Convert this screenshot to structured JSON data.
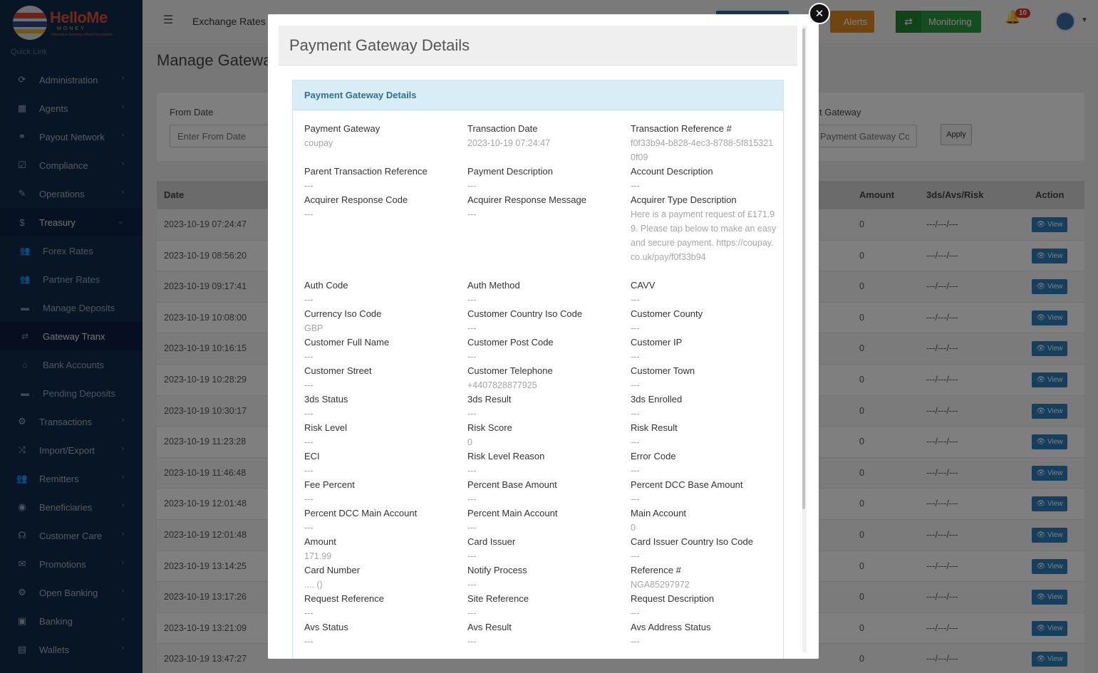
{
  "logo": {
    "name": "HelloMe",
    "sub": "MONEY",
    "tagline": "Alternative banking without boundaries"
  },
  "sidebar": {
    "quick_link": "Quick Link",
    "items": [
      {
        "label": "Administration",
        "icon": "circle-arrow-icon"
      },
      {
        "label": "Agents",
        "icon": "building-icon"
      },
      {
        "label": "Payout Network",
        "icon": "handshake-icon"
      },
      {
        "label": "Compliance",
        "icon": "check-square-icon"
      },
      {
        "label": "Operations",
        "icon": "wrench-icon"
      },
      {
        "label": "Treasury",
        "icon": "dollar-icon"
      }
    ],
    "treasury_sub": [
      {
        "label": "Forex Rates",
        "icon": "users-icon"
      },
      {
        "label": "Partner Rates",
        "icon": "users-icon"
      },
      {
        "label": "Manage Deposits",
        "icon": "card-icon"
      },
      {
        "label": "Gateway Tranx",
        "icon": "exchange-icon"
      },
      {
        "label": "Bank Accounts",
        "icon": "bank-icon"
      },
      {
        "label": "Pending Deposits",
        "icon": "card-icon"
      }
    ],
    "items_after": [
      {
        "label": "Transactions",
        "icon": "cogs-icon"
      },
      {
        "label": "Import/Export",
        "icon": "shuffle-icon"
      },
      {
        "label": "Remitters",
        "icon": "users-icon"
      },
      {
        "label": "Beneficiaries",
        "icon": "user-circle-icon"
      },
      {
        "label": "Customer Care",
        "icon": "headset-icon"
      },
      {
        "label": "Promotions",
        "icon": "gift-icon"
      },
      {
        "label": "Open Banking",
        "icon": "gear-icon"
      },
      {
        "label": "Banking",
        "icon": "money-icon"
      },
      {
        "label": "Wallets",
        "icon": "wallet-icon"
      }
    ]
  },
  "topbar": {
    "exchange_rates": "Exchange Rates",
    "alerts": "Alerts",
    "monitoring": "Monitoring",
    "notif_count": "10"
  },
  "page": {
    "title": "Manage Gatewa",
    "from_date_label": "From Date",
    "from_date_placeholder": "Enter From Date",
    "gateway_label": "t Gateway",
    "gateway_placeholder": "Payment Gateway Cod",
    "apply": "Apply",
    "columns": {
      "date": "Date",
      "amount": "Amount",
      "risk": "3ds/Avs/Risk",
      "action": "Action"
    },
    "rows": [
      {
        "date": "2023-10-19 07:24:47",
        "amount": "0",
        "risk": "---/---/---",
        "action": "View"
      },
      {
        "date": "2023-10-19 08:56:20",
        "amount": "0",
        "risk": "---/---/---",
        "action": "View"
      },
      {
        "date": "2023-10-19 09:17:41",
        "amount": "0",
        "risk": "---/---/---",
        "action": "View"
      },
      {
        "date": "2023-10-19 10:08:00",
        "amount": "0",
        "risk": "---/---/---",
        "action": "View"
      },
      {
        "date": "2023-10-19 10:16:15",
        "amount": "0",
        "risk": "---/---/---",
        "action": "View"
      },
      {
        "date": "2023-10-19 10:28:29",
        "amount": "0",
        "risk": "---/---/---",
        "action": "View"
      },
      {
        "date": "2023-10-19 10:30:17",
        "amount": "0",
        "risk": "---/---/---",
        "action": "View"
      },
      {
        "date": "2023-10-19 11:23:28",
        "amount": "0",
        "risk": "---/---/---",
        "action": "View"
      },
      {
        "date": "2023-10-19 11:46:48",
        "amount": "0",
        "risk": "---/---/---",
        "action": "View"
      },
      {
        "date": "2023-10-19 12:01:48",
        "amount": "0",
        "risk": "---/---/---",
        "action": "View"
      },
      {
        "date": "2023-10-19 12:01:48",
        "amount": "0",
        "risk": "---/---/---",
        "action": "View"
      },
      {
        "date": "2023-10-19 13:14:25",
        "amount": "0",
        "risk": "---/---/---",
        "action": "View"
      },
      {
        "date": "2023-10-19 13:17:26",
        "amount": "0",
        "risk": "---/---/---",
        "action": "View"
      },
      {
        "date": "2023-10-19 13:21:09",
        "amount": "0",
        "risk": "---/---/---",
        "action": "View"
      },
      {
        "date": "2023-10-19 13:47:27",
        "amount": "0",
        "risk": "---/---/---",
        "action": "View"
      }
    ]
  },
  "modal": {
    "title": "Payment Gateway Details",
    "panel_title": "Payment Gateway Details",
    "rows": [
      [
        {
          "k": "Payment Gateway",
          "v": "coupay"
        },
        {
          "k": "Transaction Date",
          "v": "2023-10-19 07:24:47"
        },
        {
          "k": "Transaction Reference #",
          "v": "f0f33b94-b828-4ec3-8788-5f8153210f09"
        }
      ],
      [
        {
          "k": "Parent Transaction Reference",
          "v": "---"
        },
        {
          "k": "Payment Description",
          "v": "---"
        },
        {
          "k": "Account Description",
          "v": "---"
        }
      ],
      [
        {
          "k": "Acquirer Response Code",
          "v": "---"
        },
        {
          "k": "Acquirer Response Message",
          "v": "---"
        },
        {
          "k": "Acquirer Type Description",
          "v": "Here is a payment request of £171.99. Please tap below to make an easy and secure payment. https://coupay.co.uk/pay/f0f33b94"
        }
      ],
      [
        {
          "k": "Auth Code",
          "v": "---"
        },
        {
          "k": "Auth Method",
          "v": "---"
        },
        {
          "k": "CAVV",
          "v": "---"
        }
      ],
      [
        {
          "k": "Currency Iso Code",
          "v": "GBP"
        },
        {
          "k": "Customer Country Iso Code",
          "v": "---"
        },
        {
          "k": "Customer County",
          "v": "---"
        }
      ],
      [
        {
          "k": "Customer Full Name",
          "v": "---"
        },
        {
          "k": "Customer Post Code",
          "v": "---"
        },
        {
          "k": "Customer IP",
          "v": "---"
        }
      ],
      [
        {
          "k": "Customer Street",
          "v": "---"
        },
        {
          "k": "Customer Telephone",
          "v": "+4407828877925"
        },
        {
          "k": "Customer Town",
          "v": "---"
        }
      ],
      [
        {
          "k": "3ds Status",
          "v": "---"
        },
        {
          "k": "3ds Result",
          "v": "---"
        },
        {
          "k": "3ds Enrolled",
          "v": "---"
        }
      ],
      [
        {
          "k": "Risk Level",
          "v": "---"
        },
        {
          "k": "Risk Score",
          "v": "0"
        },
        {
          "k": "Risk Result",
          "v": "---"
        }
      ],
      [
        {
          "k": "ECI",
          "v": "---"
        },
        {
          "k": "Risk Level Reason",
          "v": "---"
        },
        {
          "k": "Error Code",
          "v": "---"
        }
      ],
      [
        {
          "k": "Fee Percent",
          "v": "---"
        },
        {
          "k": "Percent Base Amount",
          "v": "---"
        },
        {
          "k": "Percent DCC Base Amount",
          "v": "---"
        }
      ],
      [
        {
          "k": "Percent DCC Main Account",
          "v": "---"
        },
        {
          "k": "Percent Main Account",
          "v": "---"
        },
        {
          "k": "Main Account",
          "v": "0"
        }
      ],
      [
        {
          "k": "Amount",
          "v": "171.99"
        },
        {
          "k": "Card Issuer",
          "v": "---"
        },
        {
          "k": "Card Issuer Country Iso Code",
          "v": "---"
        }
      ],
      [
        {
          "k": "Card Number",
          "v": ".... ()"
        },
        {
          "k": "Notify Process",
          "v": "---"
        },
        {
          "k": "Reference #",
          "v": "NGA85297972"
        }
      ],
      [
        {
          "k": "Request Reference",
          "v": "---"
        },
        {
          "k": "Site Reference",
          "v": "---"
        },
        {
          "k": "Request Description",
          "v": "---"
        }
      ],
      [
        {
          "k": "Avs Status",
          "v": "---"
        },
        {
          "k": "Avs Result",
          "v": "---"
        },
        {
          "k": "Avs Address Status",
          "v": "---"
        }
      ]
    ]
  }
}
